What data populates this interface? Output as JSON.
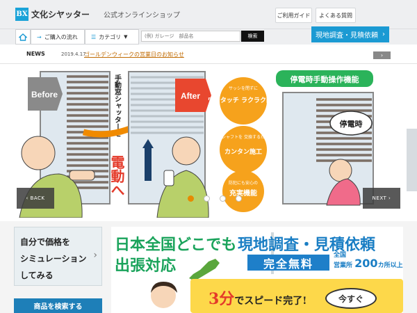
{
  "header": {
    "logo_mark": "BX",
    "logo_name": "文化シヤッター",
    "subtitle": "公式オンラインショップ",
    "links": [
      "ご利用ガイド",
      "よくある質問"
    ]
  },
  "nav": {
    "tabs": [
      "ご購入の流れ",
      "カテゴリ"
    ],
    "search_placeholder": "(例) ガレージ　部品名",
    "search_button": "検索",
    "quote_button": "現地調査・見積依頼"
  },
  "news": {
    "label": "NEWS",
    "date": "2019.4.17",
    "text": "ゴールデンウィークの営業日のお知らせ",
    "arrow": "›"
  },
  "hero": {
    "before": "Before",
    "after": "After",
    "vertical_caption": "手動窓シャッターを",
    "headline": "電動へ",
    "features": [
      {
        "top": "サッシを閉ずに",
        "main": "ワンタッチ\nラクラク開閉"
      },
      {
        "top": "巻取シャフトを\n交換するだけの",
        "main": "カンタン施工"
      },
      {
        "top": "防犯にも安心の",
        "main": "充実機能"
      }
    ],
    "blackout_title": "停電時手動操作機能",
    "blackout_label": "停電時",
    "prev": "‹ BACK",
    "next": "NEXT ›",
    "active_slide": 1,
    "slide_count": 4
  },
  "sidebar": {
    "sim_lines": [
      "自分で価格を",
      "シミュレーション",
      "してみる"
    ],
    "sim_arrow": "›",
    "product_search": "商品を検索する"
  },
  "banner": {
    "left_line1": "日本全国どこでも",
    "left_line2": "出張対応",
    "right_title": "現地調査・見積依頼",
    "free": "完全無料",
    "offices_prefix": "全国",
    "offices_line2": "営業所",
    "offices_num": "200",
    "offices_suffix": "カ所",
    "offices_tail": "以上",
    "speed_num": "3分",
    "speed_text": "でスピード完了!",
    "now": "今すぐ"
  },
  "colors": {
    "accent": "#1b9ad3",
    "orange": "#f08a00",
    "green": "#1aa35b",
    "red": "#e43a2a"
  }
}
